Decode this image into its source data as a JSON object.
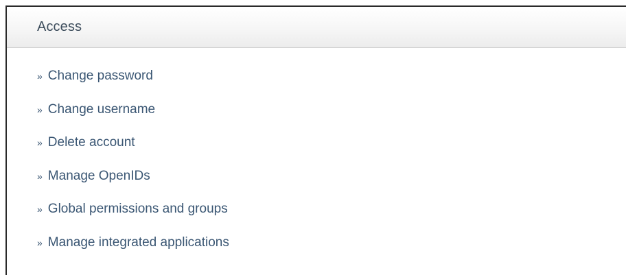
{
  "panel": {
    "title": "Access",
    "bullet": "»",
    "links": [
      {
        "label": "Change password"
      },
      {
        "label": "Change username"
      },
      {
        "label": "Delete account"
      },
      {
        "label": "Manage OpenIDs"
      },
      {
        "label": "Global permissions and groups"
      },
      {
        "label": "Manage integrated applications"
      }
    ]
  },
  "colors": {
    "link": "#3a5673",
    "title": "#3d4d5c",
    "border": "#2a2a2a"
  }
}
